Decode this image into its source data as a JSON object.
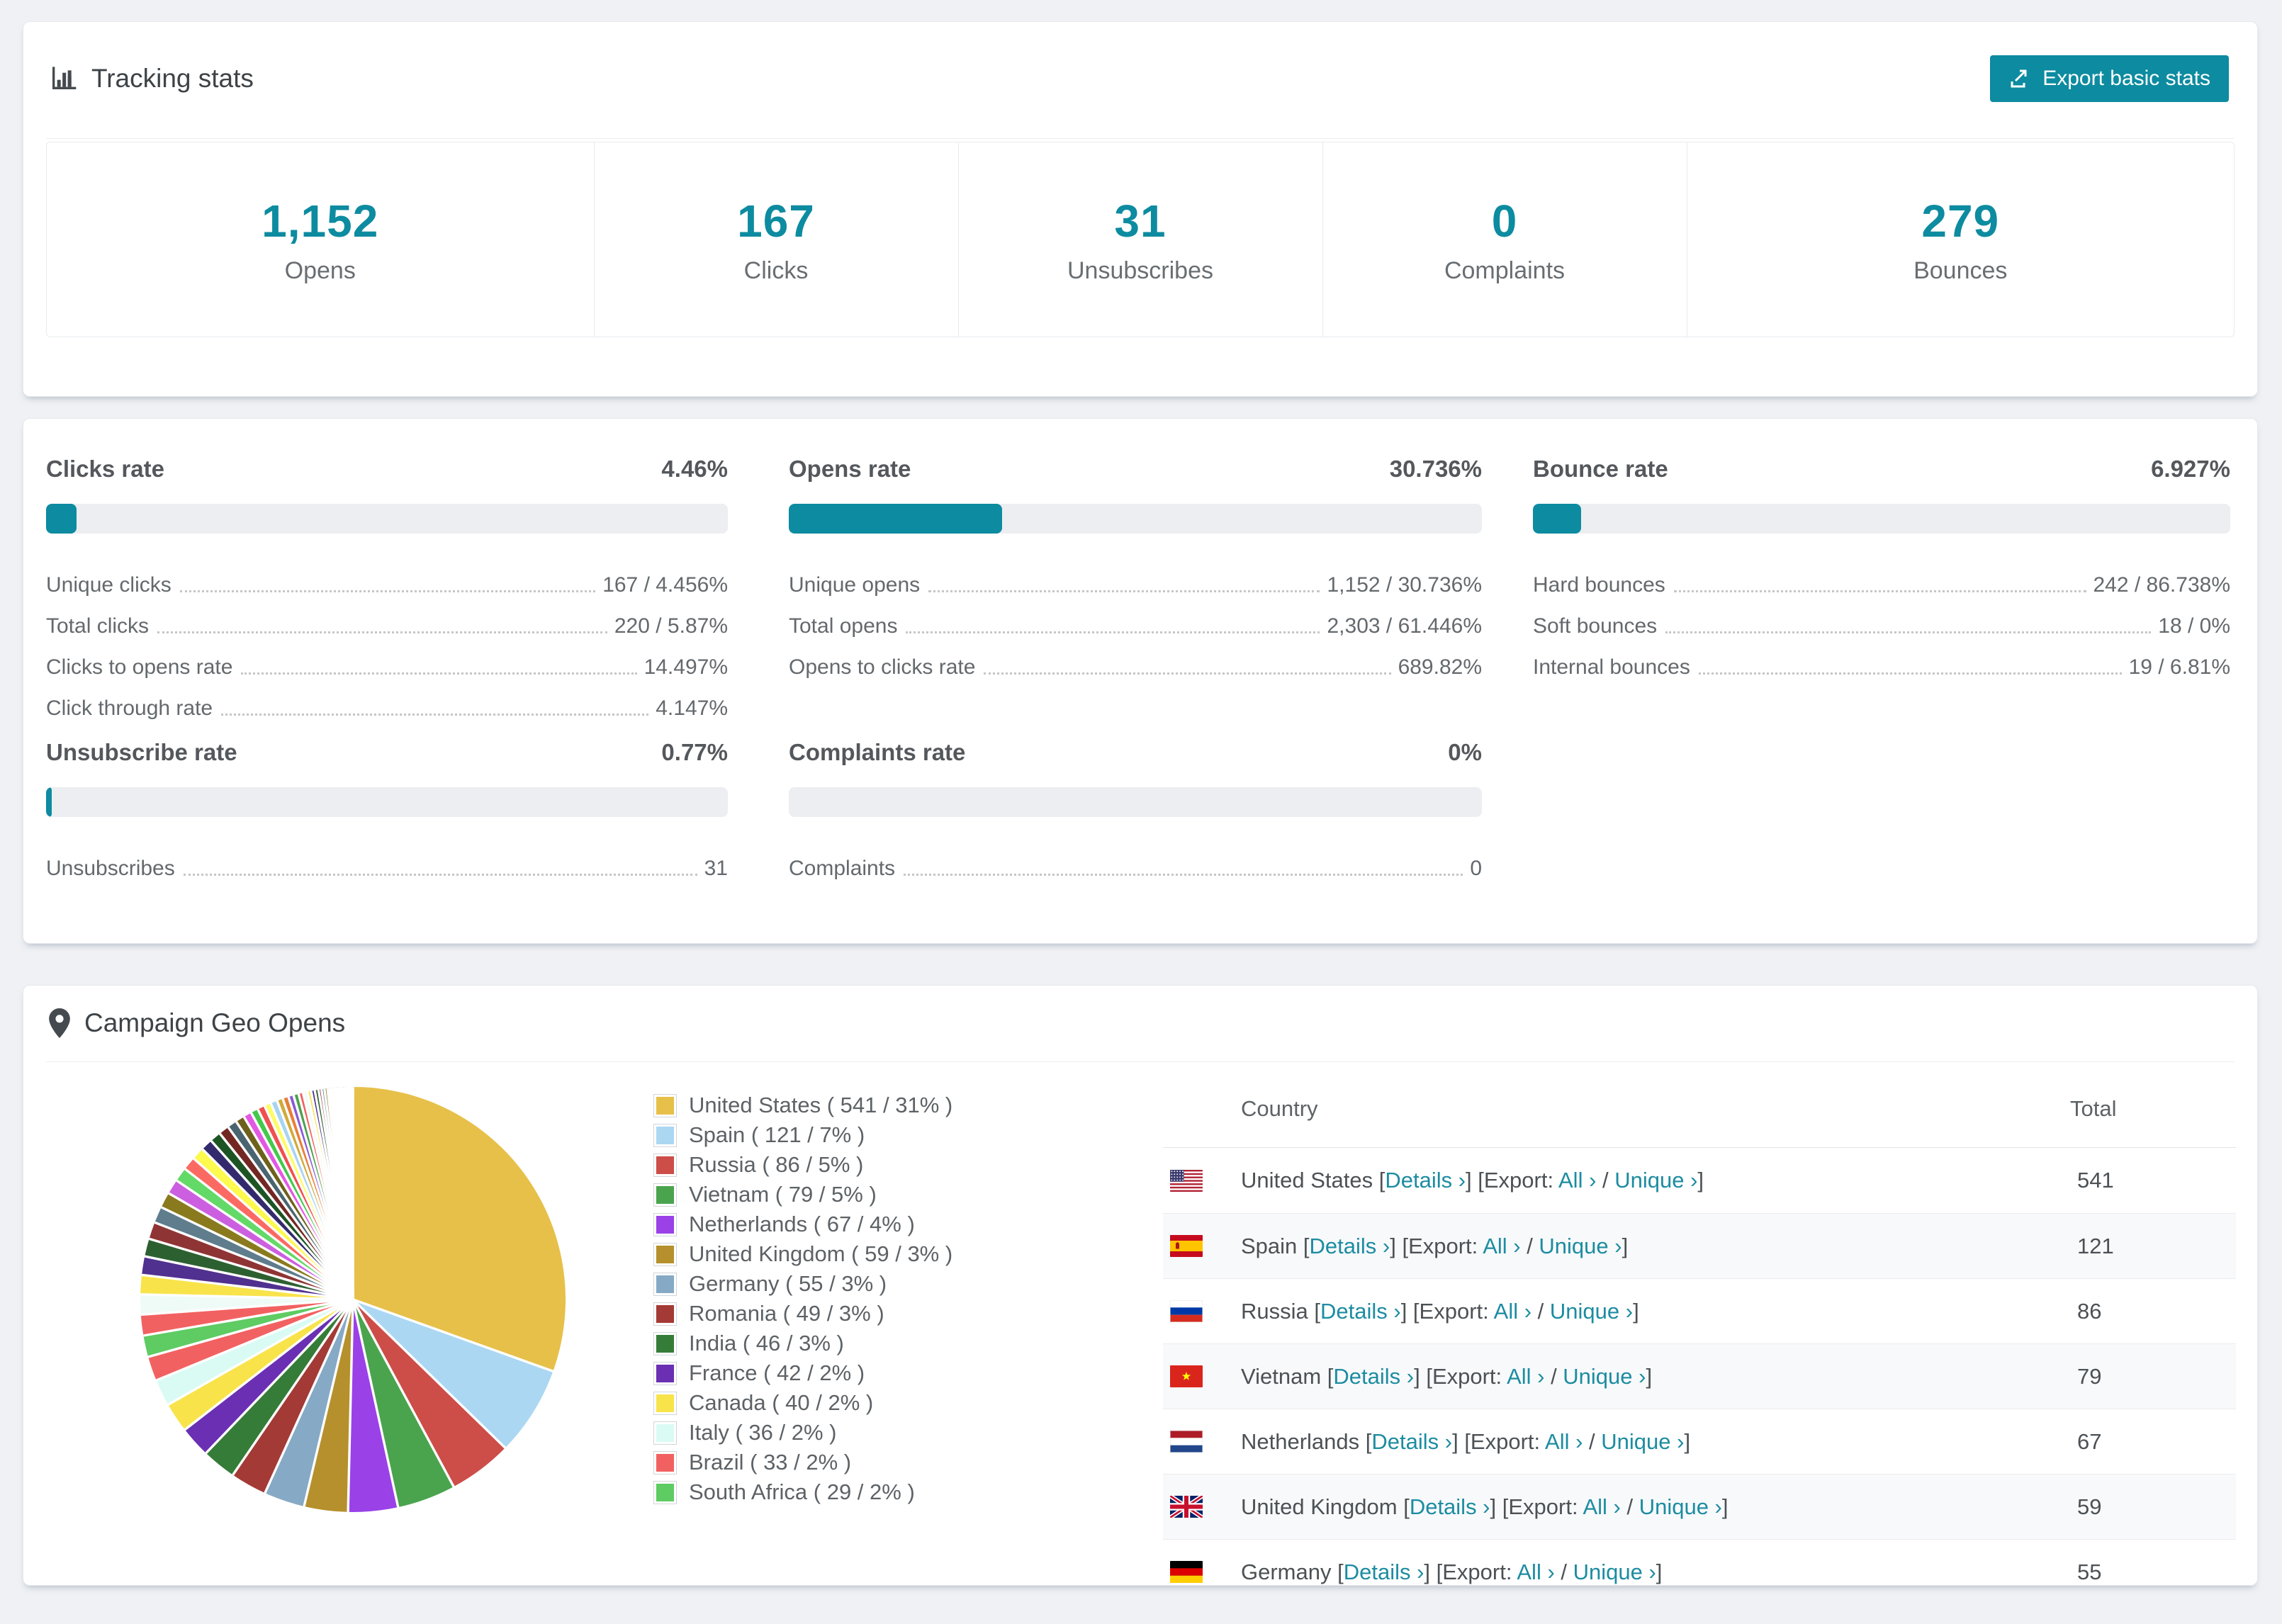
{
  "colors": {
    "accent": "#0d8ba0",
    "bar_track": "#eceef1",
    "link": "#1c8ca1"
  },
  "tracking": {
    "title": "Tracking stats",
    "export_label": "Export basic stats",
    "stats": [
      {
        "value": "1,152",
        "label": "Opens"
      },
      {
        "value": "167",
        "label": "Clicks"
      },
      {
        "value": "31",
        "label": "Unsubscribes"
      },
      {
        "value": "0",
        "label": "Complaints"
      },
      {
        "value": "279",
        "label": "Bounces"
      }
    ]
  },
  "rates": [
    {
      "title": "Clicks rate",
      "percent": "4.46%",
      "bar": 4.46,
      "rows": [
        [
          "Unique clicks",
          "167 / 4.456%"
        ],
        [
          "Total clicks",
          "220 / 5.87%"
        ],
        [
          "Clicks to opens rate",
          "14.497%"
        ],
        [
          "Click through rate",
          "4.147%"
        ]
      ]
    },
    {
      "title": "Opens rate",
      "percent": "30.736%",
      "bar": 30.736,
      "rows": [
        [
          "Unique opens",
          "1,152 / 30.736%"
        ],
        [
          "Total opens",
          "2,303 / 61.446%"
        ],
        [
          "Opens to clicks rate",
          "689.82%"
        ]
      ]
    },
    {
      "title": "Bounce rate",
      "percent": "6.927%",
      "bar": 6.927,
      "rows": [
        [
          "Hard bounces",
          "242 / 86.738%"
        ],
        [
          "Soft bounces",
          "18 / 0%"
        ],
        [
          "Internal bounces",
          "19 / 6.81%"
        ]
      ]
    },
    {
      "title": "Unsubscribe rate",
      "percent": "0.77%",
      "bar": 0.77,
      "rows": [
        [
          "Unsubscribes",
          "31"
        ]
      ]
    },
    {
      "title": "Complaints rate",
      "percent": "0%",
      "bar": 0,
      "rows": [
        [
          "Complaints",
          "0"
        ]
      ]
    }
  ],
  "geo": {
    "title": "Campaign Geo Opens",
    "table": {
      "headers": {
        "country": "Country",
        "total": "Total"
      },
      "links": {
        "details": "Details ›",
        "export_prefix": "Export:",
        "all": "All ›",
        "unique": "Unique ›"
      },
      "rows": [
        {
          "name": "United States",
          "flag": "us",
          "total": "541"
        },
        {
          "name": "Spain",
          "flag": "es",
          "total": "121"
        },
        {
          "name": "Russia",
          "flag": "ru",
          "total": "86"
        },
        {
          "name": "Vietnam",
          "flag": "vn",
          "total": "79"
        },
        {
          "name": "Netherlands",
          "flag": "nl",
          "total": "67"
        },
        {
          "name": "United Kingdom",
          "flag": "gb",
          "total": "59"
        },
        {
          "name": "Germany",
          "flag": "de",
          "total": "55"
        }
      ]
    }
  },
  "chart_data": {
    "type": "pie",
    "title": "Campaign Geo Opens",
    "legend_position": "right",
    "series": [
      {
        "name": "United States",
        "value": 541,
        "pct": "31%",
        "color": "#e7c04a"
      },
      {
        "name": "Spain",
        "value": 121,
        "pct": "7%",
        "color": "#abd7f3"
      },
      {
        "name": "Russia",
        "value": 86,
        "pct": "5%",
        "color": "#cd4d49"
      },
      {
        "name": "Vietnam",
        "value": 79,
        "pct": "5%",
        "color": "#4aa44e"
      },
      {
        "name": "Netherlands",
        "value": 67,
        "pct": "4%",
        "color": "#9a41e8"
      },
      {
        "name": "United Kingdom",
        "value": 59,
        "pct": "3%",
        "color": "#b5902c"
      },
      {
        "name": "Germany",
        "value": 55,
        "pct": "3%",
        "color": "#86a9c5"
      },
      {
        "name": "Romania",
        "value": 49,
        "pct": "3%",
        "color": "#a33a35"
      },
      {
        "name": "India",
        "value": 46,
        "pct": "3%",
        "color": "#357c39"
      },
      {
        "name": "France",
        "value": 42,
        "pct": "2%",
        "color": "#6a2fb3"
      },
      {
        "name": "Canada",
        "value": 40,
        "pct": "2%",
        "color": "#f8e34b"
      },
      {
        "name": "Italy",
        "value": 36,
        "pct": "2%",
        "color": "#dafbf4"
      },
      {
        "name": "Brazil",
        "value": 33,
        "pct": "2%",
        "color": "#f26161"
      },
      {
        "name": "South Africa",
        "value": 29,
        "pct": "2%",
        "color": "#5ecb63"
      }
    ],
    "others_values": [
      28,
      27,
      26,
      25,
      24,
      23,
      22,
      21,
      20,
      19,
      18,
      17,
      16,
      15,
      14,
      13,
      12,
      11,
      10,
      10,
      9,
      9,
      8,
      8,
      7,
      7,
      6,
      6,
      5,
      5,
      5,
      4,
      4,
      4,
      3,
      3,
      3,
      3,
      2,
      2,
      2,
      2,
      2,
      2,
      1,
      1,
      1,
      1,
      1,
      1,
      1,
      1,
      1,
      1
    ],
    "others_palette": [
      "#f26161",
      "#effbf7",
      "#f8e34b",
      "#50318f",
      "#2d6031",
      "#8f3434",
      "#5f7d8c",
      "#8a7a1e",
      "#cc5fe0",
      "#63d967",
      "#fb6a62",
      "#fdf94d",
      "#332a6e",
      "#1d5424",
      "#732723",
      "#4a6570",
      "#6e611b",
      "#e358e3",
      "#43c94a",
      "#ef5050",
      "#fdfb66",
      "#a8d4f0",
      "#d2a93a",
      "#e77f38",
      "#8a5bd6",
      "#4ba24b"
    ]
  }
}
